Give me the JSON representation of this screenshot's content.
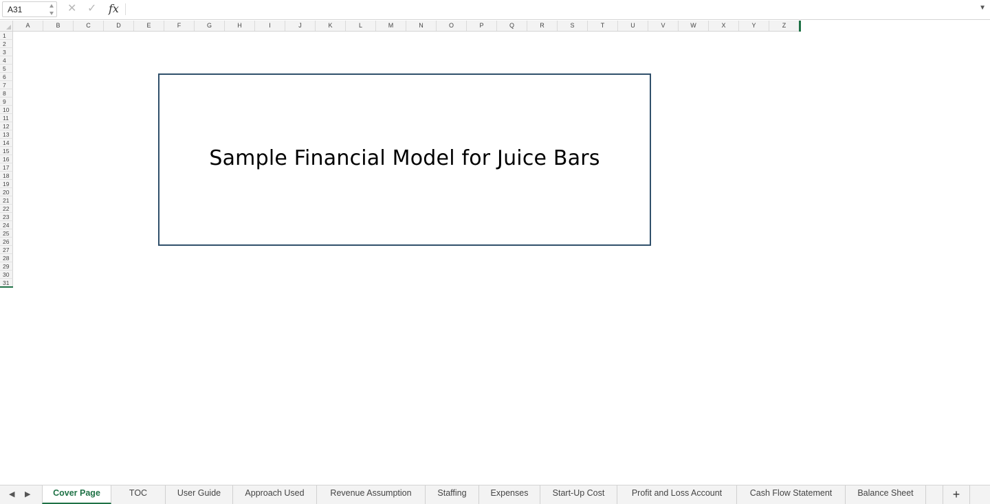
{
  "formula_bar": {
    "name_box": "A31",
    "formula": ""
  },
  "columns": [
    "A",
    "B",
    "C",
    "D",
    "E",
    "F",
    "G",
    "H",
    "I",
    "J",
    "K",
    "L",
    "M",
    "N",
    "O",
    "P",
    "Q",
    "R",
    "S",
    "T",
    "U",
    "V",
    "W",
    "X",
    "Y",
    "Z"
  ],
  "rows": [
    "1",
    "2",
    "3",
    "4",
    "5",
    "6",
    "7",
    "8",
    "9",
    "10",
    "11",
    "12",
    "13",
    "14",
    "15",
    "16",
    "17",
    "18",
    "19",
    "20",
    "21",
    "22",
    "23",
    "24",
    "25",
    "26",
    "27",
    "28",
    "29",
    "30",
    "31"
  ],
  "sheet": {
    "title": "Sample Financial Model for Juice Bars"
  },
  "tabs": [
    {
      "label": "Cover Page",
      "active": true
    },
    {
      "label": "TOC"
    },
    {
      "label": "User Guide"
    },
    {
      "label": "Approach Used"
    },
    {
      "label": "Revenue Assumption"
    },
    {
      "label": "Staffing"
    },
    {
      "label": "Expenses"
    },
    {
      "label": "Start-Up Cost"
    },
    {
      "label": "Profit and Loss Account"
    },
    {
      "label": "Cash Flow Statement"
    },
    {
      "label": "Balance Sheet"
    }
  ],
  "colors": {
    "accent": "#1e7145",
    "box_border": "#2f4f6a"
  }
}
